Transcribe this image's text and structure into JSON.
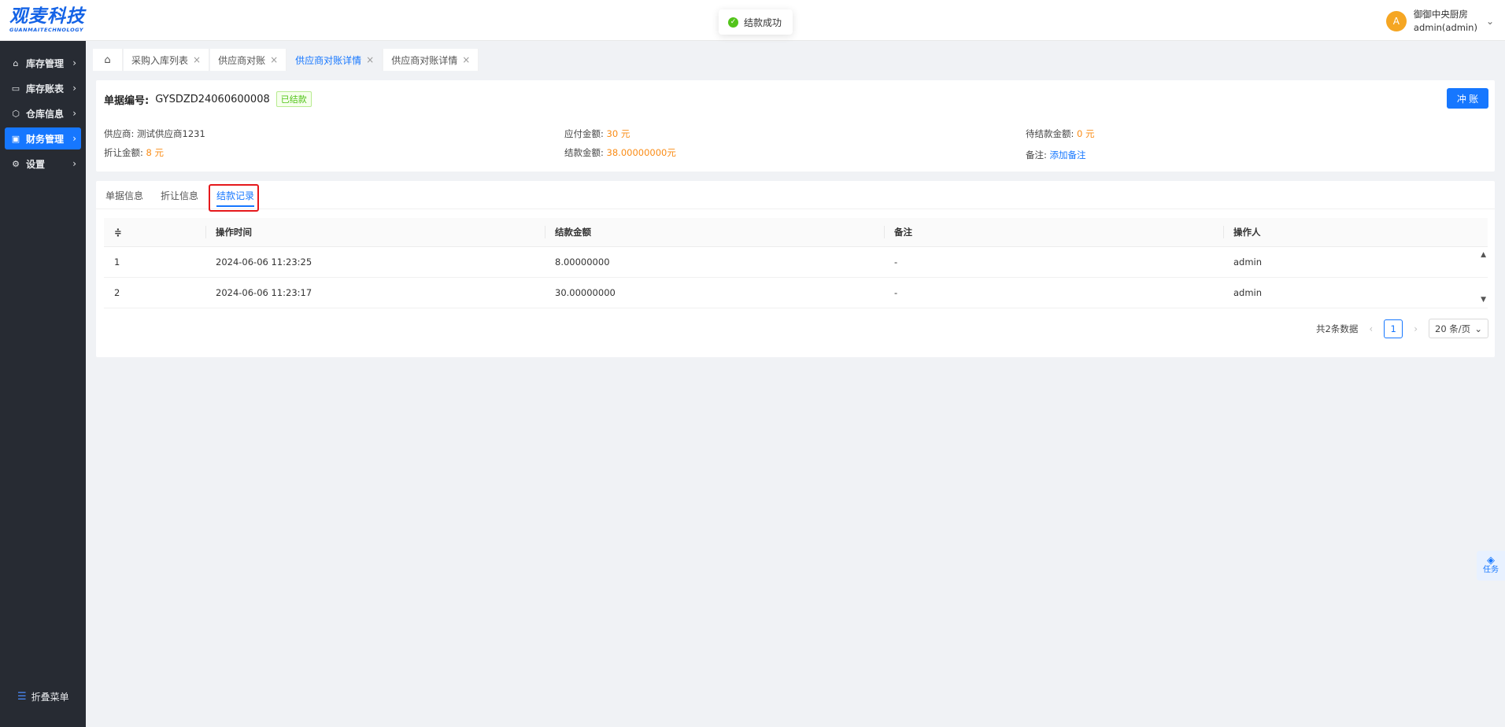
{
  "brand": {
    "name": "观麦科技",
    "tagline": "GUANMAITECHNOLOGY"
  },
  "toast": {
    "text": "结款成功"
  },
  "user": {
    "avatar_letter": "A",
    "org": "御御中央厨房",
    "account": "admin(admin)"
  },
  "sidebar": {
    "items": [
      {
        "label": "库存管理",
        "icon": "home-icon"
      },
      {
        "label": "库存账表",
        "icon": "ledger-icon"
      },
      {
        "label": "仓库信息",
        "icon": "box-icon"
      },
      {
        "label": "财务管理",
        "icon": "finance-icon",
        "active": true
      },
      {
        "label": "设置",
        "icon": "gear-icon"
      }
    ],
    "collapse_label": "折叠菜单"
  },
  "tabs": [
    {
      "label": "采购入库列表"
    },
    {
      "label": "供应商对账"
    },
    {
      "label": "供应商对账详情",
      "active": true
    },
    {
      "label": "供应商对账详情"
    }
  ],
  "header_card": {
    "doc_label": "单据编号:",
    "doc_no": "GYSDZD24060600008",
    "status": "已结款",
    "action_button": "冲 账",
    "fields": {
      "supplier_label": "供应商:",
      "supplier_value": "测试供应商1231",
      "payable_label": "应付金额:",
      "payable_value": "30 元",
      "pending_label": "待结款金额:",
      "pending_value": "0 元",
      "discount_label": "折让金额:",
      "discount_value": "8 元",
      "settled_label": "结款金额:",
      "settled_value": "38.00000000元",
      "remark_label": "备注:",
      "remark_link": "添加备注"
    }
  },
  "inner_tabs": [
    {
      "label": "单据信息"
    },
    {
      "label": "折让信息"
    },
    {
      "label": "结款记录",
      "active": true
    }
  ],
  "table": {
    "columns": [
      "操作时间",
      "结款金额",
      "备注",
      "操作人"
    ],
    "rows": [
      {
        "index": "1",
        "time": "2024-06-06 11:23:25",
        "amount": "8.00000000",
        "remark": "-",
        "operator": "admin"
      },
      {
        "index": "2",
        "time": "2024-06-06 11:23:17",
        "amount": "30.00000000",
        "remark": "-",
        "operator": "admin"
      }
    ]
  },
  "pagination": {
    "total_text": "共2条数据",
    "current_page": "1",
    "page_size": "20 条/页"
  },
  "float_task": {
    "label": "任务"
  },
  "colors": {
    "accent": "#1677ff",
    "sidebar_bg": "#272b33",
    "orange": "#fa8c16",
    "success": "#52c41a",
    "highlight": "#e5191c"
  }
}
